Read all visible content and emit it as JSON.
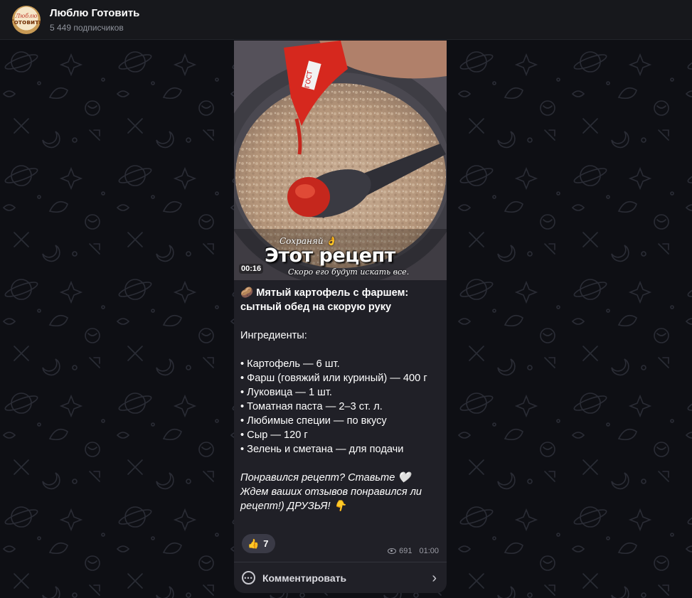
{
  "channel": {
    "avatar_text_top": "Люблю",
    "avatar_text_bottom": "Готовить",
    "title": "Люблю Готовить",
    "subscribers": "5 449 подписчиков"
  },
  "video": {
    "duration": "00:16",
    "overlay_line1": "Сохраняй 👌",
    "overlay_line2": "Этот рецепт",
    "overlay_line3": "Скоро его будут искать все.",
    "package_label": "ГОСТ"
  },
  "post": {
    "title_emoji": "🥔",
    "title": "Мятый картофель с фаршем: сытный обед на скорую руку",
    "ingredients_heading": "Ингредиенты:",
    "ingredients": [
      "• Картофель — 6 шт.",
      "• Фарш (говяжий или куриный) — 400 г",
      "• Луковица — 1 шт.",
      "• Томатная паста — 2–3 ст. л.",
      "• Любимые специи — по вкусу",
      "• Сыр — 120 г",
      "• Зелень и сметана — для подачи"
    ],
    "closing_line1": "Понравился рецепт? Ставьте 🤍",
    "closing_line2": "Ждем ваших отзывов понравился ли рецепт!) ДРУЗЬЯ! 👇"
  },
  "reaction": {
    "emoji": "👍",
    "count": "7"
  },
  "meta": {
    "views": "691",
    "time": "01:00"
  },
  "comment": {
    "label": "Комментировать"
  },
  "colors": {
    "background": "#0e0f14",
    "header": "#17181c",
    "bubble": "#202027",
    "reaction_bg": "#3a3a46",
    "pattern_stroke": "#262830"
  },
  "icons": {
    "eye": "eye-icon",
    "comment": "comment-icon",
    "chevron": "chevron-right-icon"
  }
}
